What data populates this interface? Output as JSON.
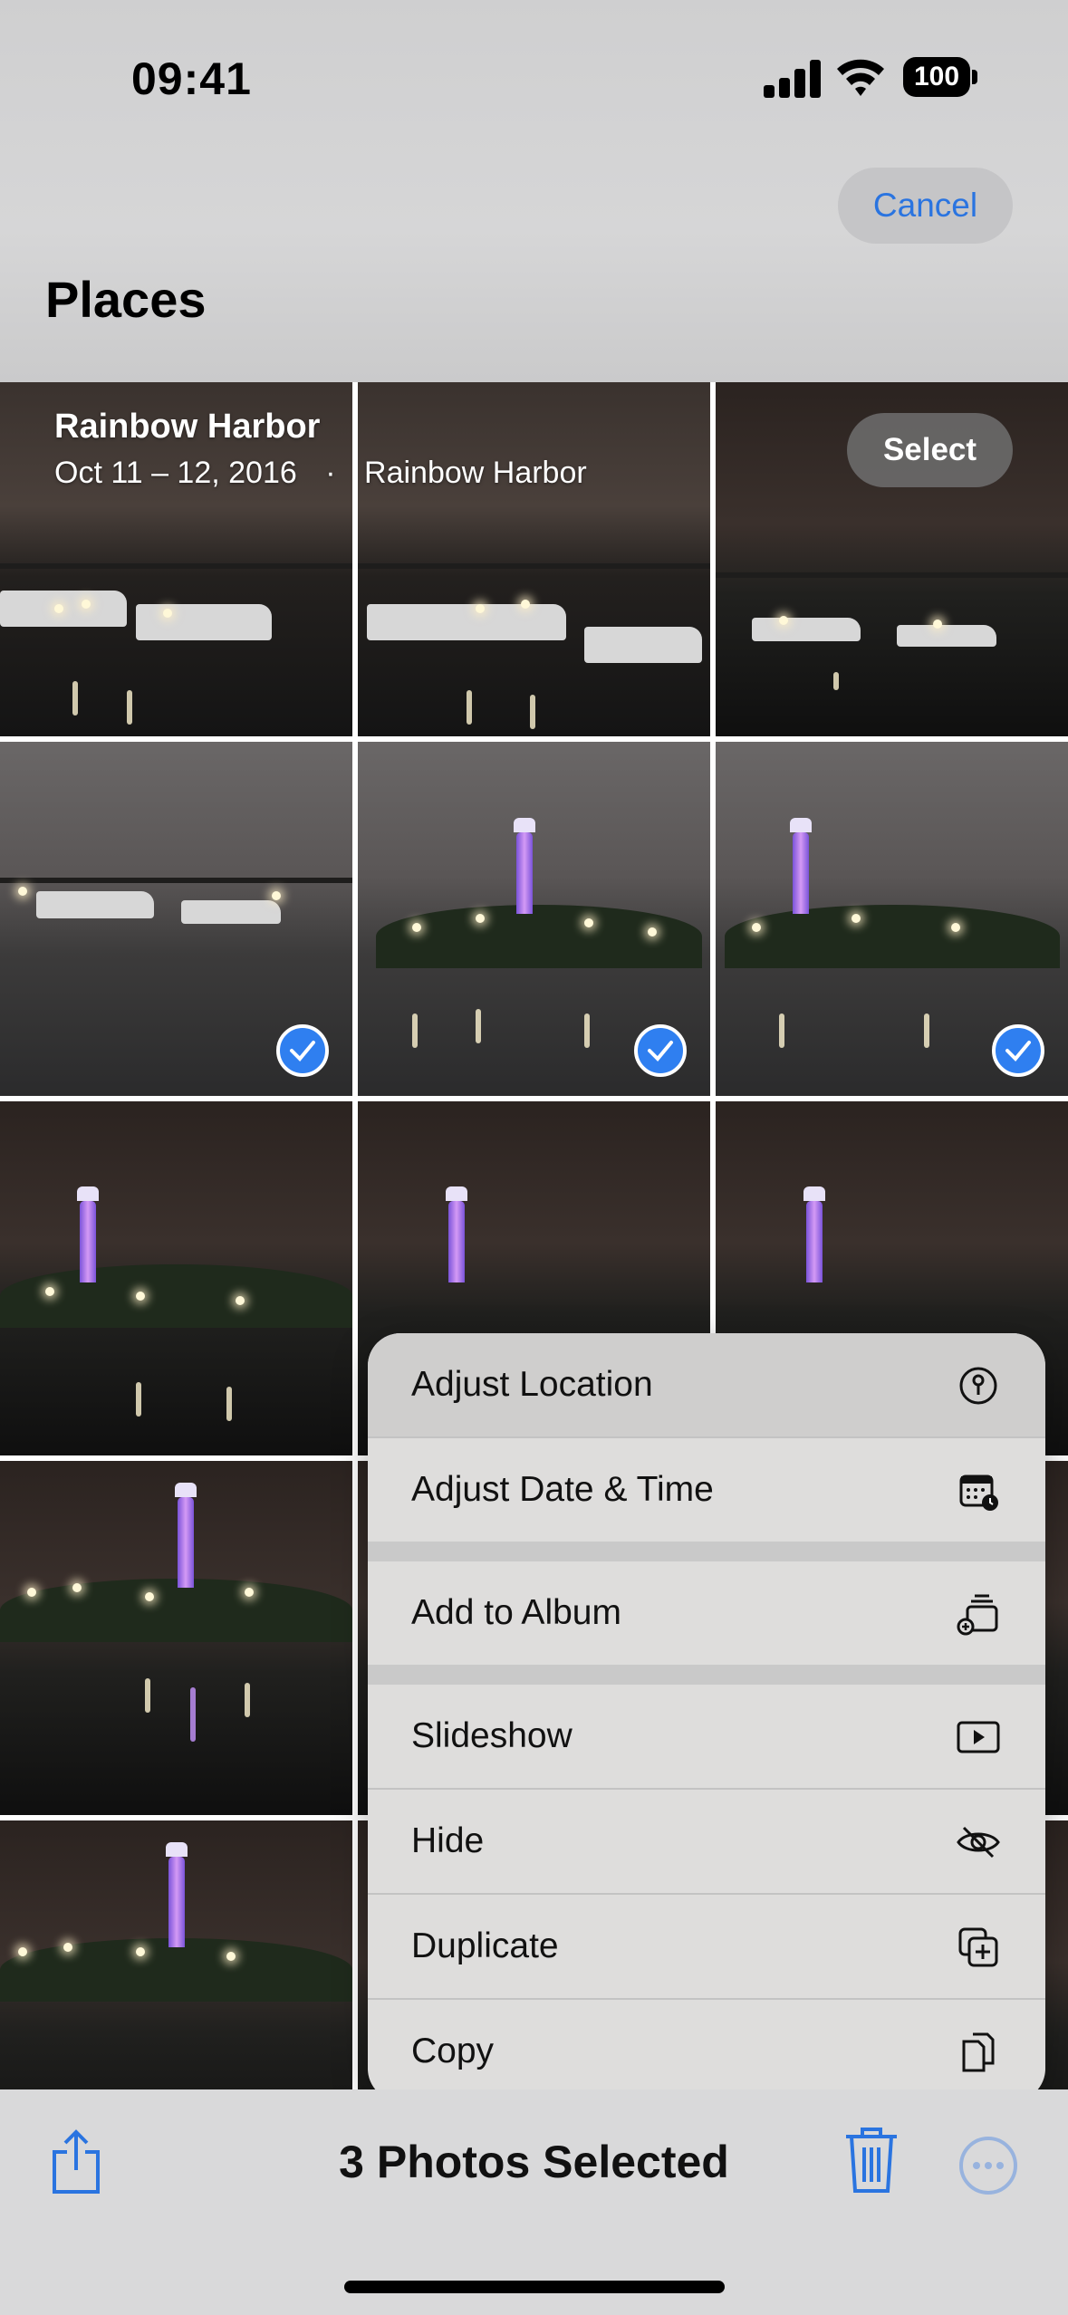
{
  "status_bar": {
    "time": "09:41",
    "battery": "100"
  },
  "header": {
    "cancel_label": "Cancel",
    "title": "Places"
  },
  "section": {
    "name": "Rainbow Harbor",
    "date_range": "Oct 11 – 12, 2016",
    "separator": "·",
    "location": "Rainbow Harbor",
    "select_label": "Select"
  },
  "grid": {
    "columns": 3,
    "selected_tiles": [
      3,
      4,
      5
    ]
  },
  "menu": {
    "items": [
      {
        "label": "Adjust Location",
        "icon": "location-pin-circle-icon"
      },
      {
        "label": "Adjust Date & Time",
        "icon": "calendar-clock-icon"
      },
      {
        "label": "Add to Album",
        "icon": "add-to-album-icon"
      },
      {
        "label": "Slideshow",
        "icon": "play-rectangle-icon"
      },
      {
        "label": "Hide",
        "icon": "eye-slash-icon"
      },
      {
        "label": "Duplicate",
        "icon": "duplicate-icon"
      },
      {
        "label": "Copy",
        "icon": "copy-documents-icon"
      }
    ]
  },
  "toolbar": {
    "selection_count_label": "3 Photos Selected",
    "share_icon": "share-icon",
    "trash_icon": "trash-icon",
    "more_icon": "ellipsis-circle-icon"
  },
  "colors": {
    "accent": "#2a74e0",
    "checkmark": "#2f7ff0"
  }
}
